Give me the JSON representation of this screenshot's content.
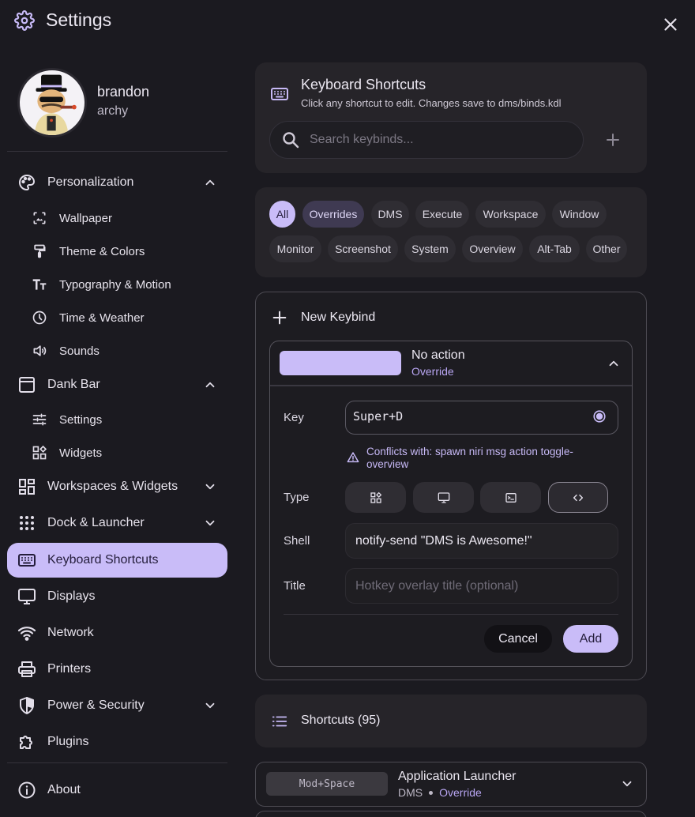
{
  "window": {
    "title": "Settings"
  },
  "profile": {
    "name": "brandon",
    "subtitle": "archy"
  },
  "sidebar": {
    "personalization": {
      "label": "Personalization",
      "children": [
        "Wallpaper",
        "Theme & Colors",
        "Typography & Motion",
        "Time & Weather",
        "Sounds"
      ]
    },
    "dank_bar": {
      "label": "Dank Bar",
      "children": [
        "Settings",
        "Widgets"
      ]
    },
    "workspaces": "Workspaces & Widgets",
    "dock": "Dock & Launcher",
    "keyboard": "Keyboard Shortcuts",
    "displays": "Displays",
    "network": "Network",
    "printers": "Printers",
    "power": "Power & Security",
    "plugins": "Plugins",
    "about": "About"
  },
  "keyboard_shortcuts": {
    "title": "Keyboard Shortcuts",
    "subtitle": "Click any shortcut to edit. Changes save to dms/binds.kdl",
    "search_placeholder": "Search keybinds..."
  },
  "filters": [
    "All",
    "Overrides",
    "DMS",
    "Execute",
    "Workspace",
    "Window",
    "Monitor",
    "Screenshot",
    "System",
    "Overview",
    "Alt-Tab",
    "Other"
  ],
  "new_keybind": {
    "title": "New Keybind",
    "action": "No action",
    "tag": "Override",
    "key_label": "Key",
    "key_value": "Super+D",
    "conflict": "Conflicts with: spawn niri msg action toggle-overview",
    "type_label": "Type",
    "shell_label": "Shell",
    "shell_value": "notify-send \"DMS is Awesome!\"",
    "title_label": "Title",
    "title_placeholder": "Hotkey overlay title (optional)",
    "cancel": "Cancel",
    "add": "Add"
  },
  "shortcuts": {
    "title": "Shortcuts (95)",
    "rows": [
      {
        "key": "Mod+Space",
        "title": "Application Launcher",
        "source": "DMS",
        "tag": "Override"
      }
    ]
  },
  "colors": {
    "accent": "#c9bcf8",
    "background": "#1b1a20",
    "card": "#262429"
  }
}
